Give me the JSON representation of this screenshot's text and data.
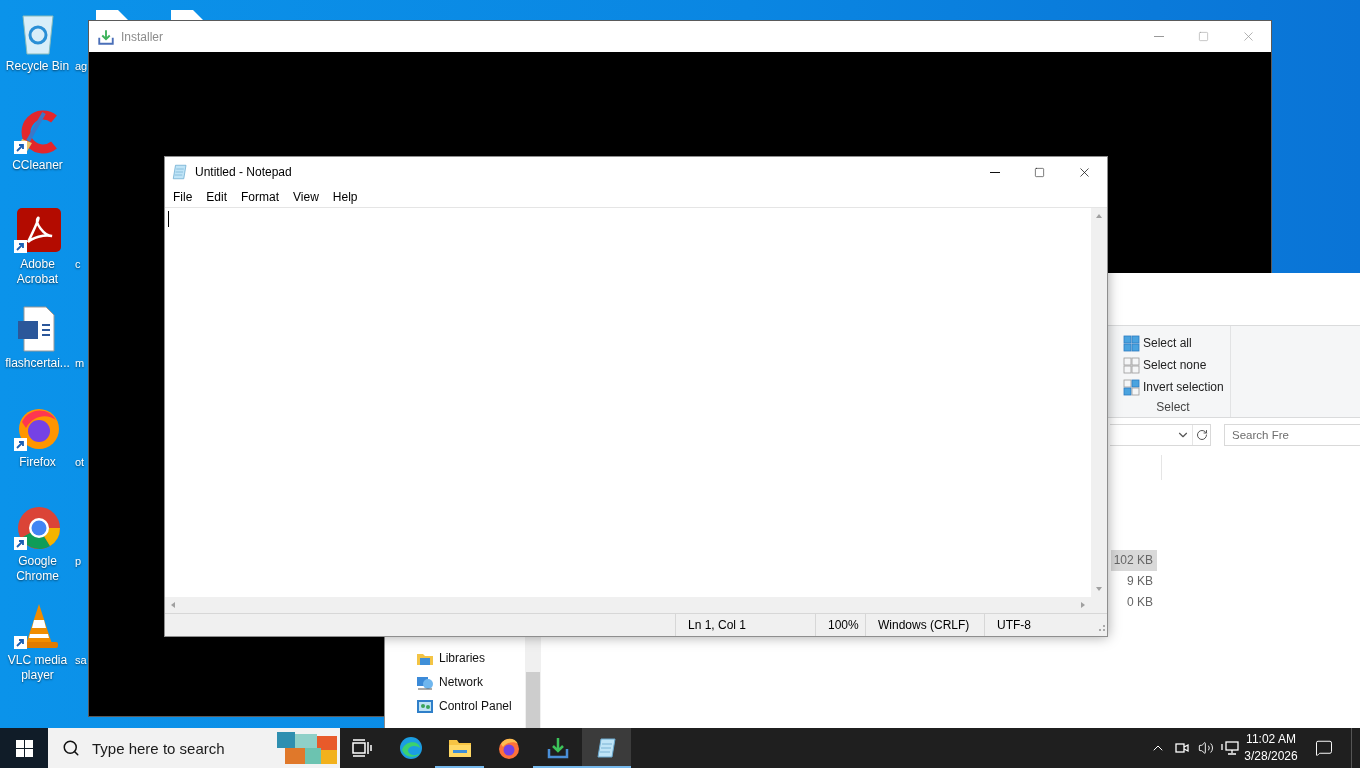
{
  "desktop": {
    "icon_rows": [
      {
        "icon": {
          "label": "Recycle Bin",
          "kind": "recycle",
          "shortcut": false
        },
        "neighbor_label": "ag"
      },
      {
        "icon": {
          "label": "CCleaner",
          "kind": "ccleaner",
          "shortcut": true
        }
      },
      {
        "icon": {
          "label": "Adobe Acrobat",
          "kind": "acrobat",
          "shortcut": true
        },
        "neighbor_label": "c"
      },
      {
        "icon": {
          "label": "flashcertai...",
          "kind": "word",
          "shortcut": false
        },
        "neighbor_label": "m"
      },
      {
        "icon": {
          "label": "Firefox",
          "kind": "firefox",
          "shortcut": true
        },
        "neighbor_label": "ot"
      },
      {
        "icon": {
          "label": "Google Chrome",
          "kind": "chrome",
          "shortcut": true
        },
        "neighbor_label": "p"
      },
      {
        "icon": {
          "label": "VLC media player",
          "kind": "vlc",
          "shortcut": true
        },
        "neighbor_label": "sa"
      }
    ]
  },
  "installer_window": {
    "title": "Installer",
    "active": false
  },
  "explorer_window": {
    "ribbon_group": {
      "title": "Select",
      "items": [
        {
          "label": "Select all",
          "kind": "all"
        },
        {
          "label": "Select none",
          "kind": "none"
        },
        {
          "label": "Invert selection",
          "kind": "invert"
        }
      ]
    },
    "search": {
      "placeholder": "Search Fre"
    },
    "nav_items": [
      {
        "label": "Libraries",
        "kind": "libraries"
      },
      {
        "label": "Network",
        "kind": "network"
      },
      {
        "label": "Control Panel",
        "kind": "control"
      }
    ],
    "file_sizes": [
      {
        "text": "102 KB",
        "selected": true
      },
      {
        "text": "9 KB",
        "selected": false
      },
      {
        "text": "0 KB",
        "selected": false
      }
    ]
  },
  "notepad_window": {
    "title": "Untitled - Notepad",
    "active": true,
    "menu": [
      "File",
      "Edit",
      "Format",
      "View",
      "Help"
    ],
    "status_bar": [
      "Ln 1, Col 1",
      "100%",
      "Windows (CRLF)",
      "UTF-8"
    ]
  },
  "taskbar": {
    "search": {
      "placeholder": "Type here to search"
    },
    "apps": [
      {
        "kind": "edge",
        "running": false,
        "selected": false
      },
      {
        "kind": "explorer",
        "running": true,
        "selected": false
      },
      {
        "kind": "firefox",
        "running": false,
        "selected": false
      },
      {
        "kind": "installer",
        "running": true,
        "selected": false
      },
      {
        "kind": "notepad",
        "running": true,
        "selected": true
      }
    ],
    "clock": {
      "time": "11:02 AM",
      "date": "3/28/2026"
    }
  }
}
